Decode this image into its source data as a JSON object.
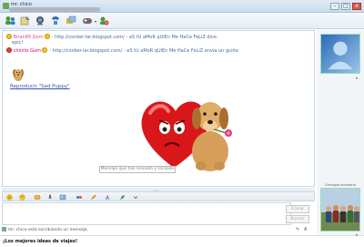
{
  "window": {
    "title": "mr. chico",
    "buttons": {
      "minimize": "–",
      "maximize": "□",
      "close": "x"
    }
  },
  "toolbar": {
    "items": [
      {
        "icon": "invite-contact-icon"
      },
      {
        "icon": "send-file-icon"
      },
      {
        "icon": "webcam-icon"
      },
      {
        "icon": "call-icon"
      },
      {
        "icon": "share-folders-icon"
      },
      {
        "icon": "games-icon"
      },
      {
        "icon": "block-icon"
      }
    ]
  },
  "conversation": {
    "messages": [
      {
        "nick": "Brian89 Gom",
        "text": "- http://conker-lar.blogspot.com/ - eS tU aMoR qUiEn Me HaCe FeLiZ dice:",
        "continuation": "epic!"
      },
      {
        "nick": "chinito Gom",
        "text": "- http://conker-lar.blogspot.com/ - eS tU aMoR qUiEn Me HaCe FeLiZ envía un guiño"
      }
    ],
    "wink_link": "Reproducir \"Sad Puppy\"",
    "wink_caption": "Mensaje que has enviado y recibido"
  },
  "compose": {
    "send_label": "Enviar",
    "search_label": "Buscar"
  },
  "status": {
    "typing": "mr. chico está escribiendo un mensaje."
  },
  "banner": {
    "text": "¡Los mejores ideas de viajes!"
  },
  "sidebar": {
    "my_picture_label": "Consigue accesorio"
  },
  "colors": {
    "accent": "#3456a8",
    "nick": "#d14d8e",
    "message_text": "#4b6b9b"
  }
}
